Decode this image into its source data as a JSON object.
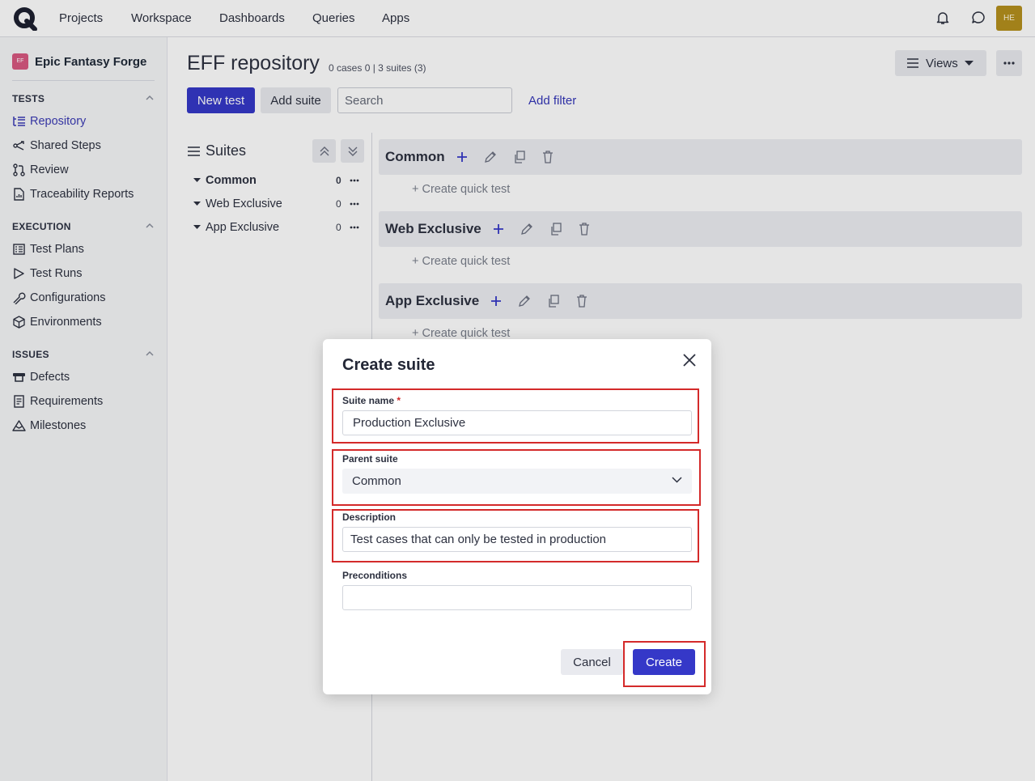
{
  "nav": {
    "items": [
      "Projects",
      "Workspace",
      "Dashboards",
      "Queries",
      "Apps"
    ],
    "avatar_initials": "HE"
  },
  "sidebar": {
    "project_badge": "EF",
    "project_name": "Epic Fantasy Forge",
    "sections": [
      {
        "title": "TESTS",
        "items": [
          "Repository",
          "Shared Steps",
          "Review",
          "Traceability Reports"
        ]
      },
      {
        "title": "EXECUTION",
        "items": [
          "Test Plans",
          "Test Runs",
          "Configurations",
          "Environments"
        ]
      },
      {
        "title": "ISSUES",
        "items": [
          "Defects",
          "Requirements",
          "Milestones"
        ]
      }
    ],
    "active_item": "Repository"
  },
  "main": {
    "title": "EFF repository",
    "subtitle": "0 cases 0 | 3 suites (3)",
    "views_label": "Views",
    "new_test_label": "New test",
    "add_suite_label": "Add suite",
    "search_placeholder": "Search",
    "add_filter_label": "Add filter",
    "suites_heading": "Suites",
    "tree": [
      {
        "name": "Common",
        "count": "0"
      },
      {
        "name": "Web Exclusive",
        "count": "0"
      },
      {
        "name": "App Exclusive",
        "count": "0"
      }
    ],
    "quick_test_label": "+ Create quick test"
  },
  "modal": {
    "title": "Create suite",
    "suite_name_label": "Suite name",
    "required_mark": "*",
    "suite_name_value": "Production Exclusive",
    "parent_label": "Parent suite",
    "parent_value": "Common",
    "description_label": "Description",
    "description_value": "Test cases that can only be tested in production",
    "preconditions_label": "Preconditions",
    "preconditions_value": "",
    "cancel_label": "Cancel",
    "create_label": "Create"
  },
  "colors": {
    "primary": "#3538c8",
    "highlight": "#d42a2a",
    "avatar": "#b5901d",
    "project_badge": "#d95881"
  }
}
